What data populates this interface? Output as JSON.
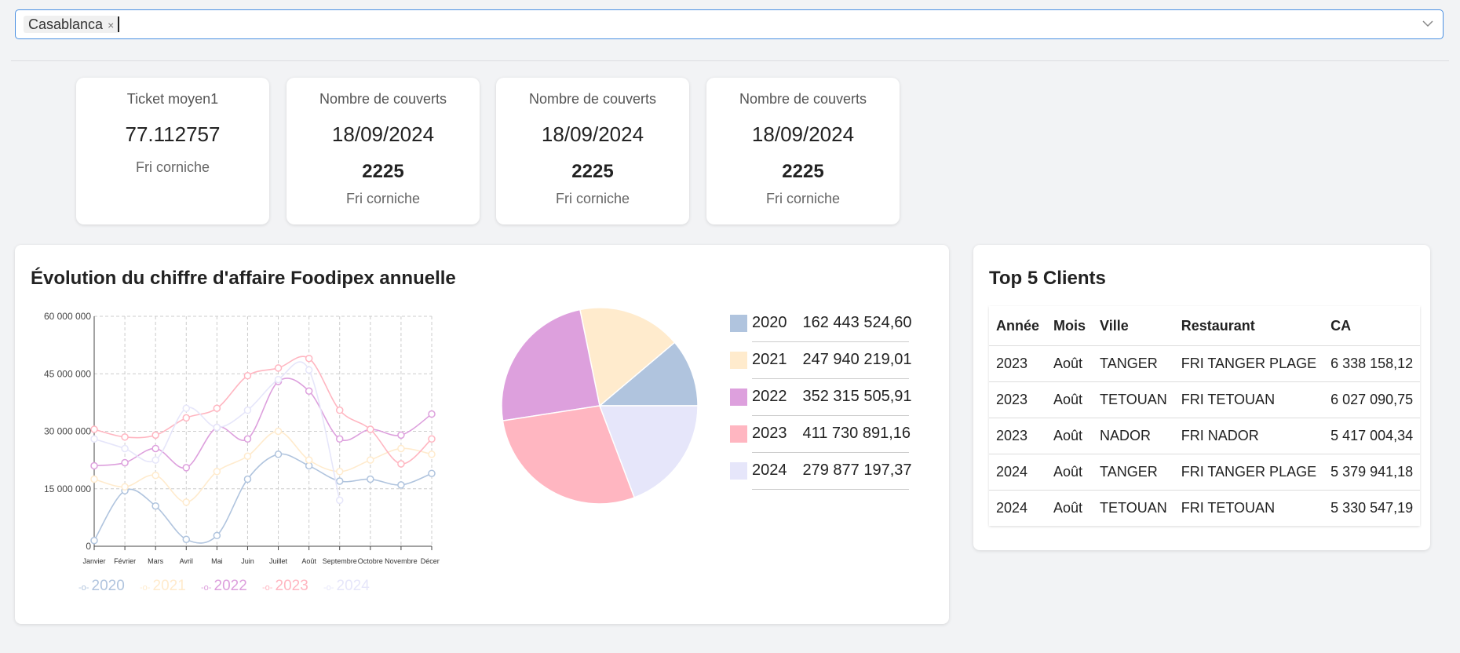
{
  "filter": {
    "tag": "Casablanca",
    "tag_close": "×"
  },
  "kpis": [
    {
      "title": "Ticket moyen1",
      "value": "77.112757",
      "sub": "Fri corniche"
    },
    {
      "title": "Nombre de couverts",
      "value": "18/09/2024",
      "big": "2225",
      "sub": "Fri corniche"
    },
    {
      "title": "Nombre de couverts",
      "value": "18/09/2024",
      "big": "2225",
      "sub": "Fri corniche"
    },
    {
      "title": "Nombre de couverts",
      "value": "18/09/2024",
      "big": "2225",
      "sub": "Fri corniche"
    }
  ],
  "revenue_panel": {
    "title": "Évolution du chiffre d'affaire Foodipex annuelle"
  },
  "colors": {
    "2020": "#b0c4de",
    "2021": "#ffebcd",
    "2022": "#dda0dd",
    "2023": "#ffb6c1",
    "2024": "#e6e6fa"
  },
  "chart_data": [
    {
      "type": "line",
      "x": [
        "Janvier",
        "Février",
        "Mars",
        "Avril",
        "Mai",
        "Juin",
        "Juillet",
        "Août",
        "Septembre",
        "Octobre",
        "Novembre",
        "Décem"
      ],
      "ylim": [
        0,
        60000000
      ],
      "yticks": [
        "0",
        "15 000 000",
        "30 000 000",
        "45 000 000",
        "60 000 000"
      ],
      "grid": true,
      "legend": "bottom-left",
      "series": [
        {
          "name": "2020",
          "values": [
            1500000,
            14500000,
            10500000,
            1800000,
            2800000,
            17500000,
            24000000,
            21000000,
            17000000,
            17500000,
            16000000,
            19000000
          ]
        },
        {
          "name": "2021",
          "values": [
            17500000,
            15500000,
            18500000,
            11500000,
            19500000,
            23500000,
            30000000,
            22500000,
            19500000,
            22500000,
            25500000,
            24000000
          ]
        },
        {
          "name": "2022",
          "values": [
            21000000,
            21800000,
            25500000,
            20500000,
            31000000,
            28000000,
            43000000,
            40500000,
            28000000,
            30500000,
            29000000,
            34500000
          ]
        },
        {
          "name": "2023",
          "values": [
            30500000,
            28500000,
            29000000,
            33500000,
            36000000,
            44500000,
            46500000,
            49000000,
            35500000,
            30500000,
            21500000,
            28000000
          ]
        },
        {
          "name": "2024",
          "values": [
            28000000,
            25500000,
            22500000,
            36000000,
            31000000,
            35500000,
            43500000,
            46000000,
            12000000,
            null,
            null,
            null
          ]
        }
      ]
    },
    {
      "type": "pie",
      "slices": [
        {
          "label": "2020",
          "value": 162443524.6,
          "display": "162 443 524,60"
        },
        {
          "label": "2021",
          "value": 247940219.01,
          "display": "247 940 219,01"
        },
        {
          "label": "2022",
          "value": 352315505.91,
          "display": "352 315 505,91"
        },
        {
          "label": "2023",
          "value": 411730891.16,
          "display": "411 730 891,16"
        },
        {
          "label": "2024",
          "value": 279877197.37,
          "display": "279 877 197,37"
        }
      ]
    }
  ],
  "clients_panel": {
    "title": "Top 5 Clients",
    "headers": [
      "Année",
      "Mois",
      "Ville",
      "Restaurant",
      "CA"
    ],
    "rows": [
      [
        "2023",
        "Août",
        "TANGER",
        "FRI TANGER PLAGE",
        "6 338 158,12"
      ],
      [
        "2023",
        "Août",
        "TETOUAN",
        "FRI TETOUAN",
        "6 027 090,75"
      ],
      [
        "2023",
        "Août",
        "NADOR",
        "FRI NADOR",
        "5 417 004,34"
      ],
      [
        "2024",
        "Août",
        "TANGER",
        "FRI TANGER PLAGE",
        "5 379 941,18"
      ],
      [
        "2024",
        "Août",
        "TETOUAN",
        "FRI TETOUAN",
        "5 330 547,19"
      ]
    ]
  }
}
